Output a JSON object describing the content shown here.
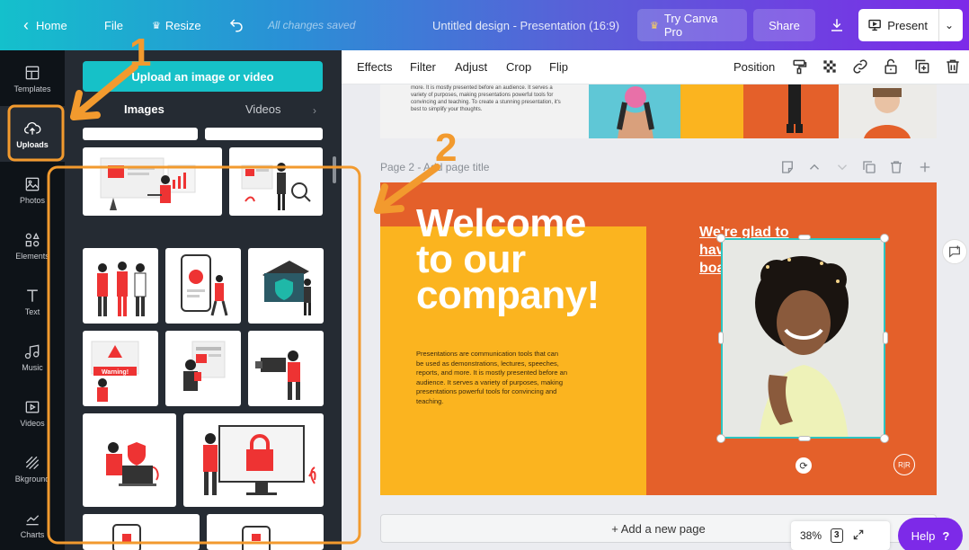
{
  "topbar": {
    "home_label": "Home",
    "file_label": "File",
    "resize_label": "Resize",
    "save_status": "All changes saved",
    "doc_title": "Untitled design - Presentation (16:9)",
    "try_pro_label": "Try Canva Pro",
    "share_label": "Share",
    "present_label": "Present"
  },
  "rail": {
    "items": [
      {
        "label": "Templates",
        "icon": "templates-icon"
      },
      {
        "label": "Uploads",
        "icon": "upload-cloud-icon"
      },
      {
        "label": "Photos",
        "icon": "photo-icon"
      },
      {
        "label": "Elements",
        "icon": "shapes-icon"
      },
      {
        "label": "Text",
        "icon": "text-icon"
      },
      {
        "label": "Music",
        "icon": "music-icon"
      },
      {
        "label": "Videos",
        "icon": "video-icon"
      },
      {
        "label": "Bkground",
        "icon": "background-icon"
      },
      {
        "label": "Charts",
        "icon": "chart-icon"
      }
    ]
  },
  "panel": {
    "upload_button": "Upload an image or video",
    "tab_images": "Images",
    "tab_videos": "Videos"
  },
  "toolbar": {
    "effects": "Effects",
    "filter": "Filter",
    "adjust": "Adjust",
    "crop": "Crop",
    "flip": "Flip",
    "position": "Position"
  },
  "canvas": {
    "prev_page_text": "more. It is mostly presented before an audience. It serves a variety of purposes, making presentations powerful tools for convincing and teaching. To create a stunning presentation, it's best to simplify your thoughts.",
    "page_label": "Page 2 - Add page title",
    "slide": {
      "headline": "Welcome\nto our\ncompany!",
      "body": "Presentations are communication tools that can be used as demonstrations, lectures, speeches, reports, and more. It is mostly presented before an audience. It serves a variety of purposes, making presentations powerful tools for convincing and teaching.",
      "glad_text": "We're glad to have you on board!",
      "badge": "R|R"
    },
    "add_page": "+ Add a new page"
  },
  "footer": {
    "zoom": "38%",
    "page_count": "3",
    "help_label": "Help",
    "help_icon": "?"
  },
  "annotations": {
    "step1": "1",
    "step2": "2"
  },
  "colors": {
    "slide_orange": "#e4602a",
    "slide_yellow": "#fbb41f",
    "upload_teal": "#16c1c8",
    "annotation_orange": "#f29a2e",
    "help_purple": "#7d2ae8"
  }
}
